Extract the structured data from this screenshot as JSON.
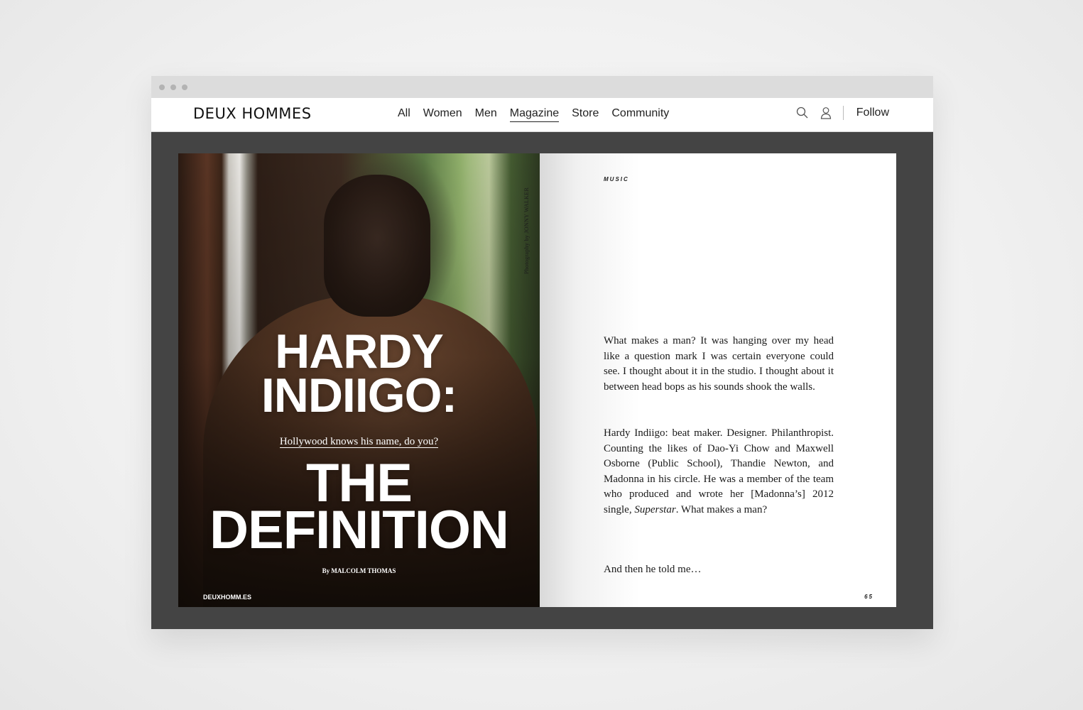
{
  "nav": {
    "logo": "DEUX HOMMES",
    "menu": [
      "All",
      "Women",
      "Men",
      "Magazine",
      "Store",
      "Community"
    ],
    "active": "Magazine",
    "follow": "Follow",
    "icons": [
      "search-icon",
      "user-icon"
    ]
  },
  "left_page": {
    "photo_credit": "Photography by JONNY WALKER",
    "headline_top": [
      "HARDY",
      "INDIIGO:"
    ],
    "dek": "Hollywood knows his name, do you?",
    "headline_bottom": [
      "THE",
      "DEFINITION"
    ],
    "byline": "By MALCOLM THOMAS",
    "site": "DEUXHOMM.ES"
  },
  "right_page": {
    "section": "MUSIC",
    "paragraph1": "What makes a man? It was hanging over my head like a question mark I was certain everyone could see. I thought about it in the studio. I thought about it between head bops as his sounds shook the walls.",
    "paragraph2_before": "Hardy Indiigo: beat maker. Designer. Philanthropist. Counting the likes of Dao-Yi Chow and Maxwell Osborne (Public School), Thandie Newton, and Madonna in his circle. He was a member of the team who produced and wrote her [Madonna’s] 2012 single, ",
    "paragraph2_italic": "Superstar",
    "paragraph2_after": ". What makes a man?",
    "paragraph3": "And then he told me…",
    "page_number": "65"
  },
  "colors": {
    "frame": "#444444",
    "chrome": "#dcdcdc",
    "nav_bg": "#ffffff"
  }
}
